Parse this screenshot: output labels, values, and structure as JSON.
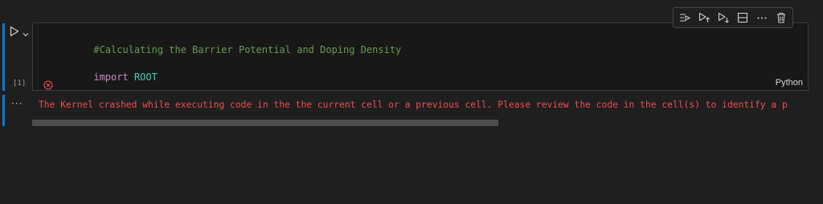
{
  "cell": {
    "execution_count": "[1]",
    "language": "Python",
    "code": {
      "line1_comment": "#Calculating the Barrier Potential and Doping Density",
      "line2_keyword": "import",
      "line2_module": "ROOT"
    },
    "status": "error"
  },
  "toolbar": {
    "buttons": [
      {
        "name": "run-by-line-icon"
      },
      {
        "name": "execute-above-icon"
      },
      {
        "name": "execute-below-icon"
      },
      {
        "name": "split-cell-icon"
      },
      {
        "name": "more-actions-icon"
      },
      {
        "name": "delete-cell-icon"
      }
    ]
  },
  "output": {
    "dots": "···",
    "error_message": "The Kernel crashed while executing code in the the current cell or a previous cell. Please review the code in the cell(s) to identify a p",
    "scroll_fraction_visible": 0.6
  },
  "colors": {
    "accent": "#0a78d4",
    "error": "#f14c4c",
    "comment": "#6a9955",
    "keyword": "#c586c0",
    "module": "#4ec9b0"
  }
}
